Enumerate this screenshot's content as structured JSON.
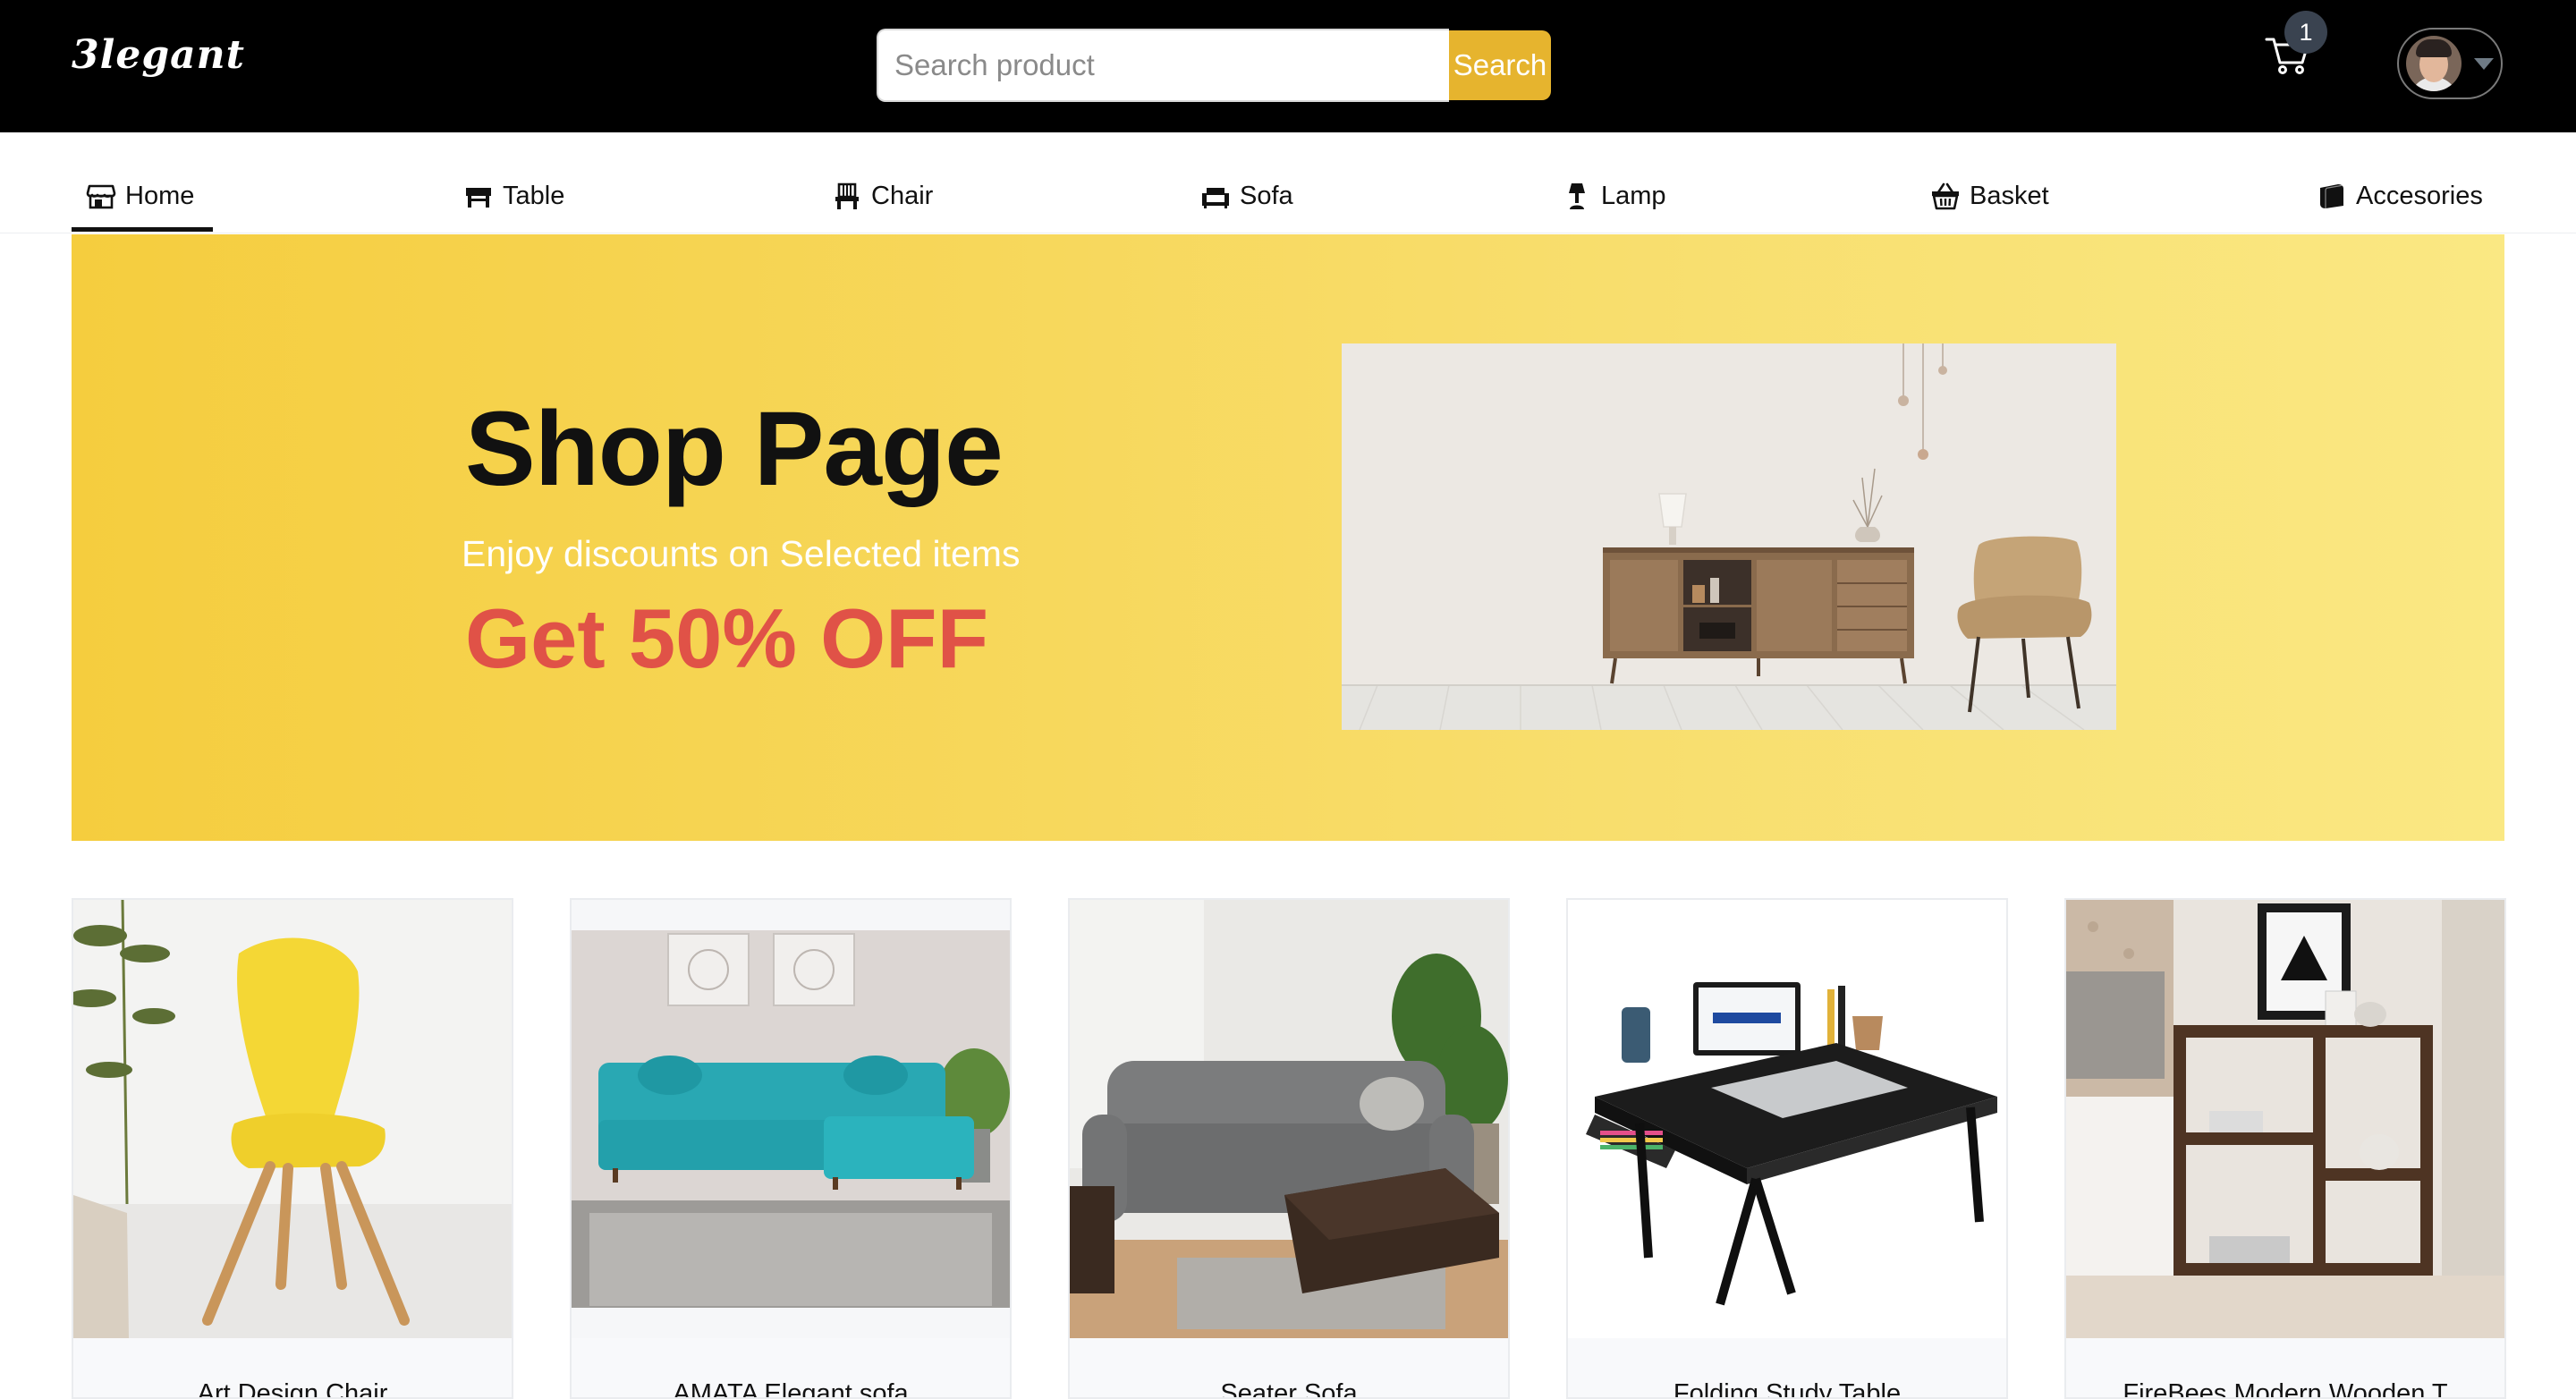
{
  "header": {
    "logo": "3legant",
    "search_placeholder": "Search product",
    "search_button": "Search",
    "cart_count": "1"
  },
  "nav": {
    "items": [
      {
        "label": "Home",
        "icon": "store-icon"
      },
      {
        "label": "Table",
        "icon": "table-icon"
      },
      {
        "label": "Chair",
        "icon": "chair-icon"
      },
      {
        "label": "Sofa",
        "icon": "sofa-icon"
      },
      {
        "label": "Lamp",
        "icon": "lamp-icon"
      },
      {
        "label": "Basket",
        "icon": "basket-icon"
      },
      {
        "label": "Accesories",
        "icon": "book-icon"
      }
    ],
    "active": "Home"
  },
  "banner": {
    "title": "Shop Page",
    "subtitle": "Enjoy discounts on Selected items",
    "offer": "Get 50% OFF"
  },
  "products": [
    {
      "name": "Art Design Chair"
    },
    {
      "name": "AMATA Elegant sofa"
    },
    {
      "name": "Seater Sofa"
    },
    {
      "name": "Folding Study Table"
    },
    {
      "name": "FireBees Modern Wooden T"
    }
  ],
  "colors": {
    "header_bg": "#000000",
    "search_button": "#e6b42e",
    "banner_start": "#f5cd3e",
    "banner_end": "#fae883",
    "offer_text": "#e05247"
  }
}
